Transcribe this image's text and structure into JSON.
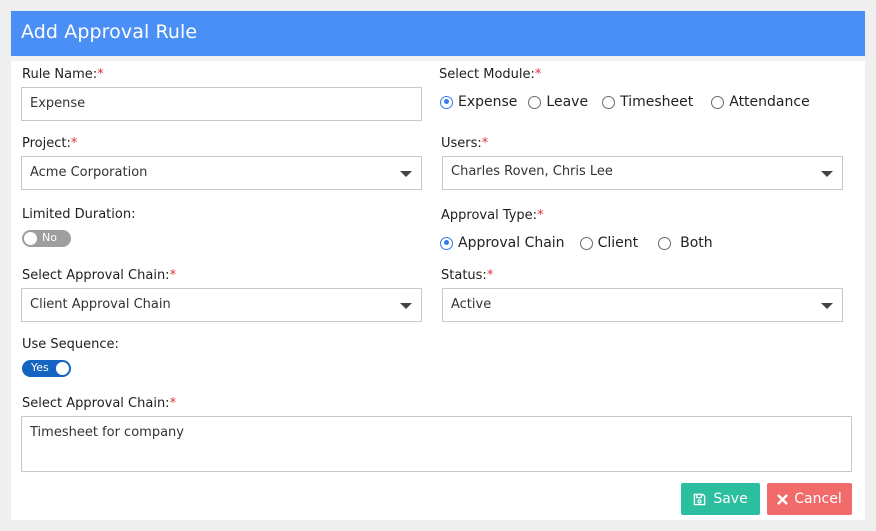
{
  "header": {
    "title": "Add Approval Rule"
  },
  "form": {
    "rule_name": {
      "label": "Rule Name:",
      "required": "*",
      "value": "Expense"
    },
    "select_module": {
      "label": "Select Module:",
      "required": "*",
      "options": [
        "Expense",
        "Leave",
        "Timesheet",
        "Attendance"
      ],
      "selected": "Expense"
    },
    "project": {
      "label": "Project:",
      "required": "*",
      "value": "Acme Corporation"
    },
    "users": {
      "label": "Users:",
      "required": "*",
      "value": "Charles Roven, Chris Lee"
    },
    "limited_duration": {
      "label": "Limited Duration:",
      "toggle_text": "No",
      "state": "off"
    },
    "approval_type": {
      "label": "Approval Type:",
      "required": "*",
      "options": [
        "Approval Chain",
        "Client",
        "Both"
      ],
      "selected": "Approval Chain"
    },
    "approval_chain": {
      "label": "Select Approval Chain:",
      "required": "*",
      "value": "Client Approval Chain"
    },
    "status": {
      "label": "Status:",
      "required": "*",
      "value": "Active"
    },
    "use_sequence": {
      "label": "Use Sequence:",
      "toggle_text": "Yes",
      "state": "on"
    },
    "approval_chain_text": {
      "label": "Select Approval Chain:",
      "required": "*",
      "value": "Timesheet for company"
    }
  },
  "buttons": {
    "save": "Save",
    "cancel": "Cancel"
  },
  "colors": {
    "header": "#4a8ff5",
    "accent": "#2f7bef",
    "toggle_on": "#1565c0",
    "save": "#2bbf9f",
    "cancel": "#f26b6b",
    "required": "#d9333f"
  },
  "icons": {
    "save": "floppy-disk-icon",
    "cancel": "x-icon",
    "dropdown": "caret-down-icon"
  }
}
